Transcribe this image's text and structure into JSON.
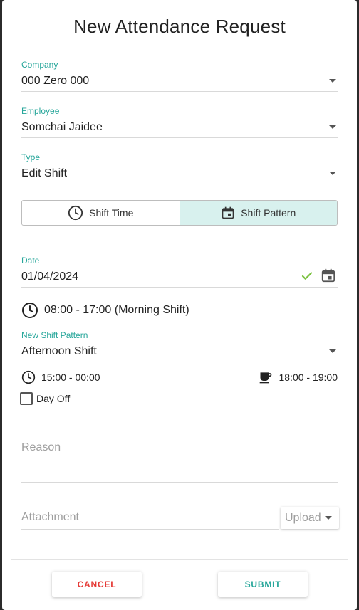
{
  "dialog": {
    "title": "New Attendance Request"
  },
  "form": {
    "company": {
      "label": "Company",
      "value": "000 Zero 000"
    },
    "employee": {
      "label": "Employee",
      "value": "Somchai Jaidee"
    },
    "type": {
      "label": "Type",
      "value": "Edit Shift"
    },
    "mode_toggle": {
      "options": [
        {
          "label": "Shift Time",
          "icon": "clock-icon",
          "selected": false
        },
        {
          "label": "Shift Pattern",
          "icon": "calendar-icon",
          "selected": true
        }
      ]
    },
    "date": {
      "label": "Date",
      "value": "01/04/2024"
    },
    "current_shift": "08:00 - 17:00 (Morning Shift)",
    "new_shift_pattern": {
      "label": "New Shift Pattern",
      "value": "Afternoon Shift"
    },
    "work_time": "15:00 - 00:00",
    "break_time": "18:00 - 19:00",
    "day_off": {
      "label": "Day Off",
      "checked": false
    },
    "reason": {
      "placeholder": "Reason"
    },
    "attachment": {
      "placeholder": "Attachment",
      "upload_label": "Upload"
    }
  },
  "actions": {
    "cancel_label": "CANCEL",
    "submit_label": "SUBMIT"
  },
  "colors": {
    "accent": "#26a69a",
    "danger": "#e53935",
    "toggle_active_bg": "#d8f1ee",
    "check": "#7cc242"
  }
}
